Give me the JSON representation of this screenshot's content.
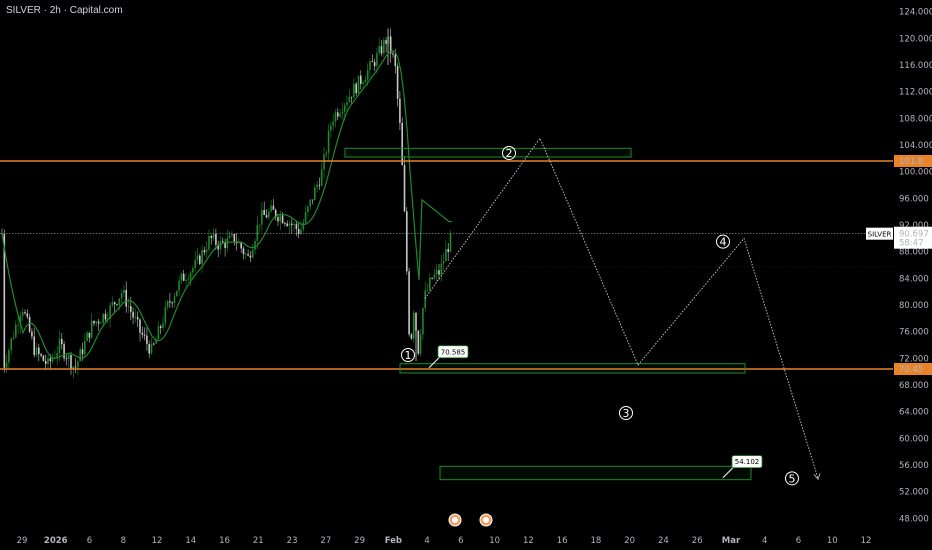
{
  "header": {
    "title": "SILVER · 2h · Capital.com"
  },
  "chart_data": {
    "type": "candlestick",
    "symbol": "SILVER",
    "interval": "2h",
    "ylim": [
      47,
      125
    ],
    "y_ticks": [
      "124.000",
      "120.000",
      "116.000",
      "112.000",
      "108.000",
      "104.000",
      "100.000",
      "96.000",
      "92.000",
      "88.000",
      "84.000",
      "80.000",
      "76.000",
      "72.000",
      "68.000",
      "64.000",
      "60.000",
      "56.000",
      "52.000",
      "48.000"
    ],
    "x_ticks": [
      "29",
      "2026",
      "6",
      "8",
      "12",
      "14",
      "16",
      "21",
      "23",
      "27",
      "29",
      "Feb",
      "4",
      "6",
      "10",
      "12",
      "16",
      "18",
      "20",
      "24",
      "26",
      "Mar",
      "4",
      "6",
      "10",
      "12"
    ],
    "last_price": {
      "label": "SILVER",
      "value": "90.697",
      "countdown": "58:47",
      "price": 90.697
    },
    "resistance_level": {
      "price": 101.6,
      "label": "101.8"
    },
    "support_level": {
      "price": 70.4,
      "label": "70.45"
    },
    "zones": [
      {
        "from_date": "Jan 25",
        "to_date": "Feb 20",
        "low": 102.2,
        "high": 103.5
      },
      {
        "from_date": "Feb 2",
        "to_date": "Mar 1",
        "low": 69.8,
        "high": 71.2
      },
      {
        "from_date": "Feb 4",
        "to_date": "Mar 2",
        "low": 53.8,
        "high": 55.8
      }
    ],
    "annotations": [
      {
        "text": "70.585",
        "price": 70.585
      },
      {
        "text": "54.102",
        "price": 54.102
      }
    ],
    "wave_labels": [
      {
        "label": "1",
        "price": 72.5
      },
      {
        "label": "2",
        "price": 102.8
      },
      {
        "label": "3",
        "price": 63.8
      },
      {
        "label": "4",
        "price": 89.5
      },
      {
        "label": "5",
        "price": 54.0
      }
    ],
    "projected_path_prices": [
      81.0,
      105.0,
      71.0,
      90.0,
      54.0
    ],
    "moving_average": {
      "color": "#1e8a2a"
    },
    "colors": {
      "up": "#1e8a2a",
      "down": "#c8c8c8",
      "level": "#e8832a",
      "zone": "#1e8a2a",
      "path": "#cfcfcf"
    }
  }
}
